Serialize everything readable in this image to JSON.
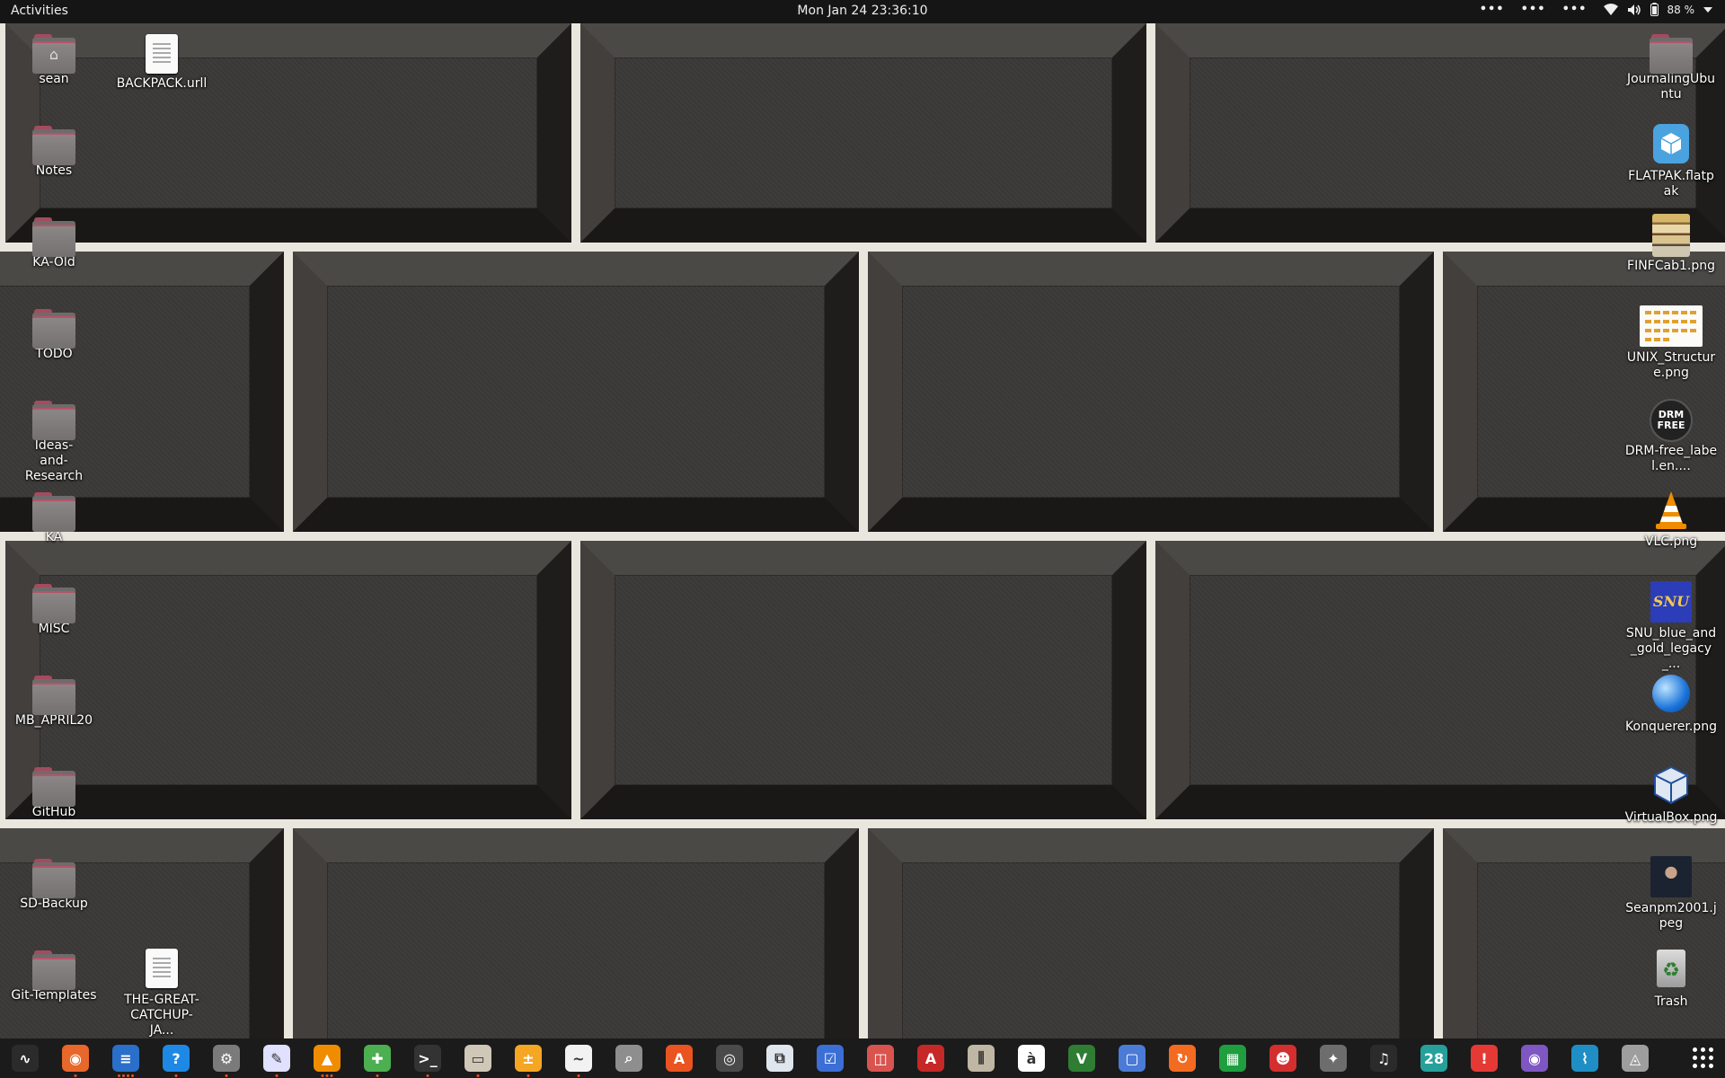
{
  "topbar": {
    "activities": "Activities",
    "clock": "Mon Jan 24  23:36:10",
    "battery": "88 %",
    "indicators": [
      "more-dots-icon",
      "more-dots-icon",
      "more-dots-icon",
      "wifi-icon",
      "volume-icon",
      "battery-icon",
      "chevron-down-icon"
    ]
  },
  "desktop": {
    "left_icons": [
      {
        "label": "sean",
        "icon": "home-folder-icon"
      },
      {
        "label": "BACKPACK.urll",
        "icon": "text-file-icon"
      },
      {
        "label": "Notes",
        "icon": "folder-icon"
      },
      {
        "label": "KA-Old",
        "icon": "folder-icon"
      },
      {
        "label": "TODO",
        "icon": "folder-icon"
      },
      {
        "label": "Ideas-and-Research",
        "icon": "folder-icon"
      },
      {
        "label": "KA",
        "icon": "folder-icon"
      },
      {
        "label": "MISC",
        "icon": "folder-icon"
      },
      {
        "label": "MB_APRIL20",
        "icon": "folder-icon"
      },
      {
        "label": "GitHub",
        "icon": "folder-icon"
      },
      {
        "label": "SD-Backup",
        "icon": "folder-icon"
      },
      {
        "label": "Git-Templates",
        "icon": "folder-icon"
      },
      {
        "label": "THE-GREAT-CATCHUP-JA...",
        "icon": "text-file-icon"
      }
    ],
    "right_icons": [
      {
        "label": "JournalingUbuntu",
        "icon": "folder-icon"
      },
      {
        "label": "FLATPAK.flatpak",
        "icon": "flatpak-icon"
      },
      {
        "label": "FINFCab1.png",
        "icon": "image-thumbnail-icon"
      },
      {
        "label": "UNIX_Structure.png",
        "icon": "image-thumbnail-icon"
      },
      {
        "label": "DRM-free_label.en....",
        "icon": "drm-free-icon"
      },
      {
        "label": "VLC.png",
        "icon": "vlc-cone-icon"
      },
      {
        "label": "SNU_blue_and_gold_legacy_...",
        "icon": "image-thumbnail-icon"
      },
      {
        "label": "Konquerer.png",
        "icon": "globe-icon"
      },
      {
        "label": "VirtualBox.png",
        "icon": "virtualbox-icon"
      },
      {
        "label": "Seanpm2001.jpeg",
        "icon": "photo-thumbnail-icon"
      },
      {
        "label": "Trash",
        "icon": "trash-icon"
      }
    ]
  },
  "dock": {
    "apps": [
      {
        "name": "system-monitor-icon",
        "glyph": "∿",
        "color": "#2b2b2b",
        "running": 0
      },
      {
        "name": "firefox-icon",
        "glyph": "◉",
        "color": "#e8672b",
        "running": 1
      },
      {
        "name": "libreoffice-writer-icon",
        "glyph": "≡",
        "color": "#2a6fc9",
        "running": 4
      },
      {
        "name": "help-icon",
        "glyph": "?",
        "color": "#1e88e5",
        "running": 1
      },
      {
        "name": "settings-icon",
        "glyph": "⚙",
        "color": "#7b7b7b",
        "running": 1
      },
      {
        "name": "text-editor-icon",
        "glyph": "✎",
        "color": "#e0e0ff",
        "running": 1
      },
      {
        "name": "vlc-icon",
        "glyph": "▲",
        "color": "#f08c00",
        "running": 3
      },
      {
        "name": "extensions-icon",
        "glyph": "✚",
        "color": "#4caf50",
        "running": 1
      },
      {
        "name": "terminal-icon",
        "glyph": ">_",
        "color": "#333333",
        "running": 1
      },
      {
        "name": "files-icon",
        "glyph": "▭",
        "color": "#cfc7b7",
        "running": 1
      },
      {
        "name": "calculator-icon",
        "glyph": "±",
        "color": "#f5a623",
        "running": 1
      },
      {
        "name": "usage-icon",
        "glyph": "∼",
        "color": "#f2f2f2",
        "running": 1
      },
      {
        "name": "image-viewer-icon",
        "glyph": "⌕",
        "color": "#8e8e8e",
        "running": 0
      },
      {
        "name": "software-center-icon",
        "glyph": "A",
        "color": "#e95420",
        "running": 0
      },
      {
        "name": "disk-utility-icon",
        "glyph": "◎",
        "color": "#4a4a4a",
        "running": 0
      },
      {
        "name": "document-scanner-icon",
        "glyph": "⧉",
        "color": "#dfe6ee",
        "running": 0
      },
      {
        "name": "todo-icon",
        "glyph": "☑",
        "color": "#3b6fd6",
        "running": 0
      },
      {
        "name": "document-viewer-icon",
        "glyph": "◫",
        "color": "#d9534f",
        "running": 0
      },
      {
        "name": "pdf-reader-icon",
        "glyph": "A",
        "color": "#c62828",
        "running": 0
      },
      {
        "name": "archive-manager-icon",
        "glyph": "⫼",
        "color": "#bfb6a3",
        "running": 0
      },
      {
        "name": "character-map-icon",
        "glyph": "à",
        "color": "#ffffff",
        "running": 0
      },
      {
        "name": "vim-icon",
        "glyph": "V",
        "color": "#2e7d32",
        "running": 0
      },
      {
        "name": "remote-desktop-icon",
        "glyph": "▢",
        "color": "#4a7bd6",
        "running": 0
      },
      {
        "name": "backup-icon",
        "glyph": "↻",
        "color": "#f26b21",
        "running": 0
      },
      {
        "name": "spreadsheet-icon",
        "glyph": "▦",
        "color": "#1e9e3e",
        "running": 0
      },
      {
        "name": "mario-game-icon",
        "glyph": "☻",
        "color": "#d32f2f",
        "running": 0
      },
      {
        "name": "gimp-icon",
        "glyph": "✦",
        "color": "#6d6d6d",
        "running": 0
      },
      {
        "name": "music-player-icon",
        "glyph": "♫",
        "color": "#2b2b2b",
        "running": 0
      },
      {
        "name": "calendar-icon",
        "glyph": "28",
        "color": "#27a09b",
        "running": 0
      },
      {
        "name": "error-report-icon",
        "glyph": "!",
        "color": "#e53935",
        "running": 0
      },
      {
        "name": "screen-recorder-icon",
        "glyph": "◉",
        "color": "#7e57c2",
        "running": 0
      },
      {
        "name": "weather-graph-icon",
        "glyph": "⌇",
        "color": "#1f8ec4",
        "running": 0
      },
      {
        "name": "startup-disk-icon",
        "glyph": "◬",
        "color": "#9e9e9e",
        "running": 0
      }
    ],
    "show_apps": "show-applications-icon"
  }
}
